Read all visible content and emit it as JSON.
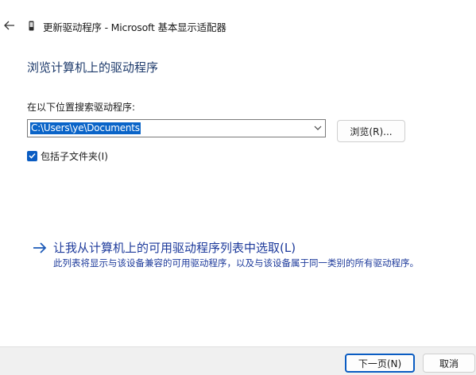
{
  "window": {
    "title": "更新驱动程序 - Microsoft 基本显示适配器"
  },
  "page": {
    "heading": "浏览计算机上的驱动程序"
  },
  "search": {
    "label": "在以下位置搜索驱动程序:",
    "path_value": "C:\\Users\\ye\\Documents",
    "browse_label": "浏览(R)..."
  },
  "subfolders": {
    "label": "包括子文件夹(I)",
    "checked": true
  },
  "pick_from_list": {
    "label": "让我从计算机上的可用驱动程序列表中选取(L)",
    "description": "此列表将显示与该设备兼容的可用驱动程序，以及与该设备属于同一类别的所有驱动程序。"
  },
  "footer": {
    "next_label": "下一页(N)",
    "cancel_label": "取消"
  },
  "colors": {
    "accent": "#0a5cc2",
    "heading": "#1d3a6b",
    "link": "#1d3a9b",
    "footer_bg": "#f0f0f0"
  }
}
